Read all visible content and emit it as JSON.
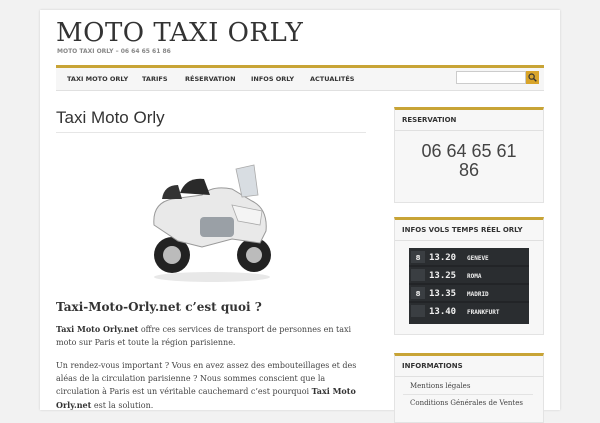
{
  "site": {
    "title": "MOTO TAXI ORLY",
    "description": "MOTO TAXI ORLY – 06 64 65 61 86"
  },
  "nav": {
    "items": [
      {
        "label": "TAXI MOTO ORLY"
      },
      {
        "label": "TARIFS"
      },
      {
        "label": "RÉSERVATION"
      },
      {
        "label": "INFOS ORLY"
      },
      {
        "label": "ACTUALITÉS"
      }
    ],
    "search_placeholder": "",
    "search_icon": "search-icon"
  },
  "main": {
    "title": "Taxi Moto Orly",
    "image": "motorcycle-image",
    "heading": "Taxi-Moto-Orly.net c’est quoi ?",
    "p1_strong": "Taxi Moto Orly.net",
    "p1_rest": " offre ces services  de transport de personnes en taxi moto sur Paris et toute la région parisienne.",
    "p2_rest": "Un rendez-vous important ? Vous en avez assez des embouteillages et des aléas de la circulation parisienne ? Nous sommes conscient que la circulation à Paris est un véritable cauchemard c’est pourquoi ",
    "p2_strong": "Taxi Moto Orly.net",
    "p2_end": " est la solution."
  },
  "sidebar": {
    "reservation": {
      "title": "RESERVATION",
      "phone_line1": "06 64 65 61",
      "phone_line2": "86"
    },
    "flights": {
      "title": "INFOS VOLS TEMPS RÉEL ORLY",
      "image": "departure-board-image",
      "board_times": [
        "13.20",
        "13.25",
        "13.35",
        "13.40"
      ],
      "board_dest": [
        "GENEVE",
        "ROMA",
        "MADRID",
        "FRANKFURT"
      ]
    },
    "informations": {
      "title": "INFORMATIONS",
      "links": [
        "Mentions légales",
        "Conditions Générales de Ventes"
      ]
    }
  }
}
